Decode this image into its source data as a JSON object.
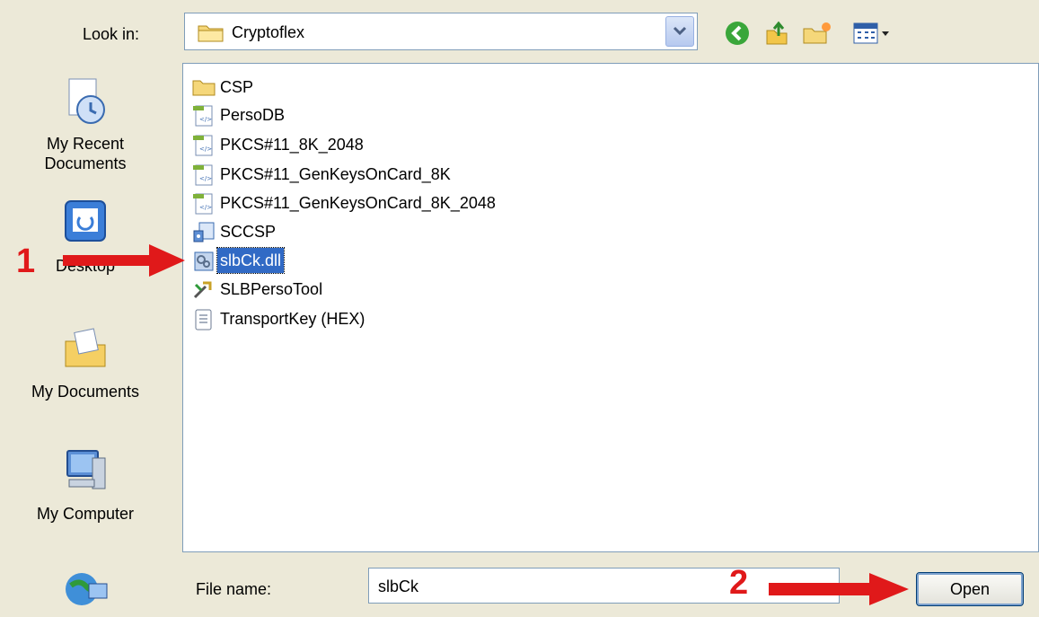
{
  "toolbar": {
    "look_in_label": "Look in:",
    "look_in_value": "Cryptoflex"
  },
  "places": [
    {
      "label_line1": "My Recent",
      "label_line2": "Documents",
      "icon": "recent-documents-icon"
    },
    {
      "label_line1": "Desktop",
      "label_line2": "",
      "icon": "desktop-icon"
    },
    {
      "label_line1": "My Documents",
      "label_line2": "",
      "icon": "my-documents-icon"
    },
    {
      "label_line1": "My Computer",
      "label_line2": "",
      "icon": "my-computer-icon"
    },
    {
      "label_line1": "",
      "label_line2": "",
      "icon": "network-places-icon"
    }
  ],
  "files": [
    {
      "name": "CSP",
      "icon": "folder-icon"
    },
    {
      "name": "PersoDB",
      "icon": "xml-file-icon"
    },
    {
      "name": "PKCS#11_8K_2048",
      "icon": "xml-file-icon"
    },
    {
      "name": "PKCS#11_GenKeysOnCard_8K",
      "icon": "xml-file-icon"
    },
    {
      "name": "PKCS#11_GenKeysOnCard_8K_2048",
      "icon": "xml-file-icon"
    },
    {
      "name": "SCCSP",
      "icon": "setup-icon"
    },
    {
      "name": "slbCk.dll",
      "icon": "dll-file-icon",
      "selected": true
    },
    {
      "name": "SLBPersoTool",
      "icon": "tool-icon"
    },
    {
      "name": "TransportKey (HEX)",
      "icon": "text-file-icon"
    }
  ],
  "footer": {
    "file_name_label": "File name:",
    "file_name_value": "slbCk",
    "open_label": "Open"
  },
  "annotations": {
    "step1": "1",
    "step2": "2",
    "color": "#e0191a"
  }
}
